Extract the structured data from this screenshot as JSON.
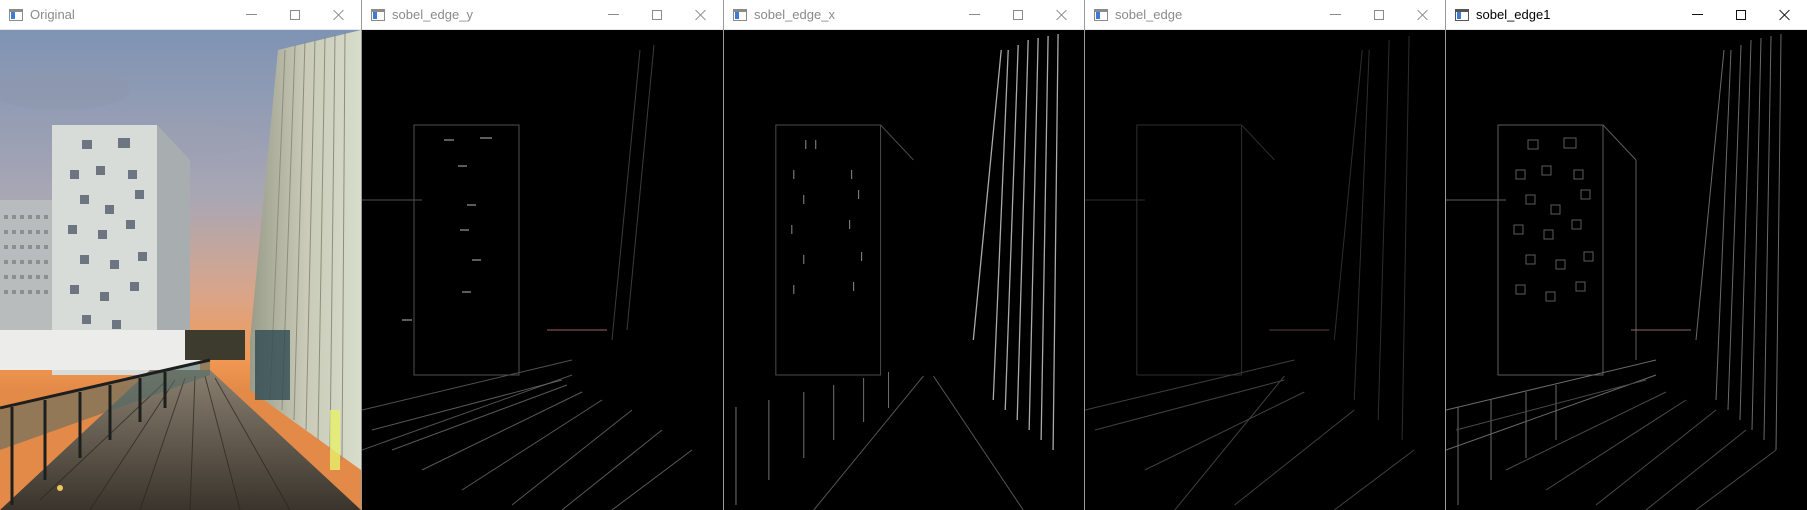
{
  "windows": [
    {
      "title": "Original",
      "active": false,
      "kind": "original"
    },
    {
      "title": "sobel_edge_y",
      "active": false,
      "kind": "edge_y"
    },
    {
      "title": "sobel_edge_x",
      "active": false,
      "kind": "edge_x"
    },
    {
      "title": "sobel_edge",
      "active": false,
      "kind": "edge_dim"
    },
    {
      "title": "sobel_edge1",
      "active": true,
      "kind": "edge_bright"
    }
  ],
  "icons": {
    "app": "opencv-window-icon",
    "minimize": "minimize-icon",
    "maximize": "maximize-icon",
    "close": "close-icon"
  },
  "colors": {
    "titlebar": "#ffffff",
    "title_inactive": "#8a8a8a",
    "title_active": "#000000",
    "sky_top": "#8a9cb8",
    "sunset": "#f0a060",
    "edge_line": "#cfcfcf"
  }
}
